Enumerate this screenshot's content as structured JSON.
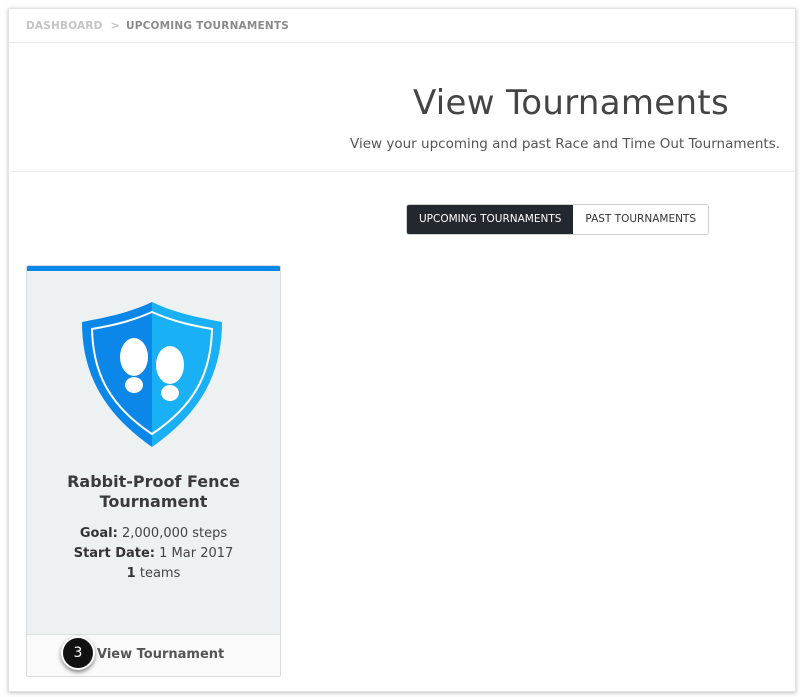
{
  "breadcrumb": {
    "home": "DASHBOARD",
    "separator": ">",
    "current": "UPCOMING TOURNAMENTS"
  },
  "header": {
    "title": "View Tournaments",
    "subtitle": "View your upcoming and past Race and Time Out Tournaments."
  },
  "tabs": [
    {
      "label": "UPCOMING TOURNAMENTS",
      "active": true
    },
    {
      "label": "PAST TOURNAMENTS",
      "active": false
    }
  ],
  "tournament": {
    "icon": "shield-footprints-icon",
    "name": "Rabbit-Proof Fence Tournament",
    "goal_label": "Goal:",
    "goal_value": "2,000,000 steps",
    "start_label": "Start Date:",
    "start_value": "1 Mar 2017",
    "teams_count": "1",
    "teams_label": "teams",
    "view_label": "View Tournament"
  },
  "annotation": {
    "step": "3"
  },
  "colors": {
    "accent": "#0a87e8",
    "shield_light": "#1ab0f5",
    "tab_active_bg": "#23272e"
  }
}
